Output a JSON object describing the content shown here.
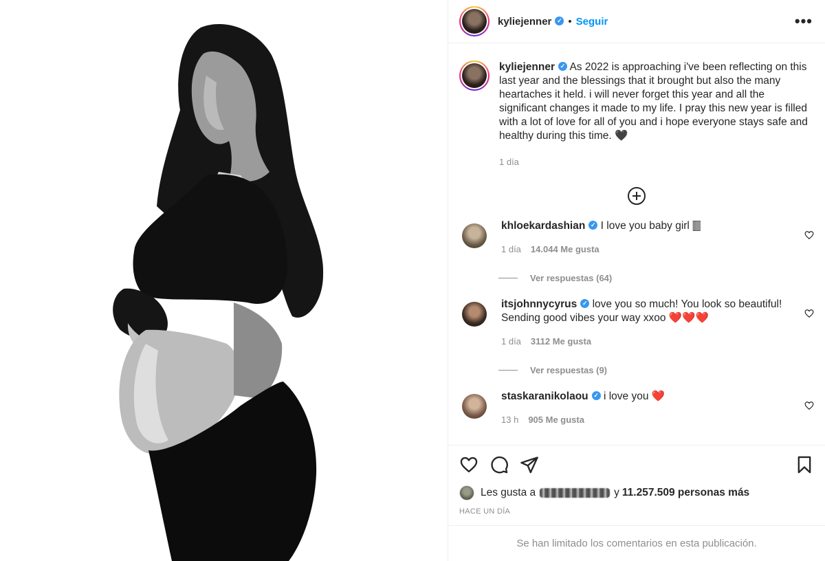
{
  "post": {
    "author": "kyliejenner",
    "follow_label": "Seguir",
    "more_label": "•••",
    "verified_mark": "✓",
    "separator": "•"
  },
  "caption": {
    "username": "kyliejenner",
    "text": "As 2022 is approaching i've been reflecting on this last year and the blessings that it brought but also the many heartaches it held. i will never forget this year and all the significant changes it made to my life. I pray this new year is filled with a lot of love for all of you and i hope everyone stays safe and healthy during this time. 🖤",
    "time": "1 día"
  },
  "comments": [
    {
      "username": "khloekardashian",
      "text": "I love you baby girl 🀫",
      "time": "1 día",
      "likes": "14.044 Me gusta",
      "replies": "Ver respuestas (64)"
    },
    {
      "username": "itsjohnnycyrus",
      "text": "love you so much! You look so beautiful! Sending good vibes your way xxoo ❤️❤️❤️",
      "time": "1 día",
      "likes": "3112 Me gusta",
      "replies": "Ver respuestas (9)"
    },
    {
      "username": "staskaranikolaou",
      "text": "i love you ❤️",
      "time": "13 h",
      "likes": "905 Me gusta"
    }
  ],
  "likes": {
    "prefix": "Les gusta a",
    "connector": "y",
    "count": "11.257.509 personas más"
  },
  "timestamp": "HACE UN DÍA",
  "comments_limited": "Se han limitado los comentarios en esta publicación.",
  "icons": [
    "heart-icon",
    "comment-icon",
    "share-icon",
    "bookmark-icon",
    "add-circle-icon",
    "more-icon",
    "verified-icon"
  ],
  "colors": {
    "follow": "#0095f6",
    "verified": "#3897f0",
    "muted": "#8e8e8e"
  }
}
